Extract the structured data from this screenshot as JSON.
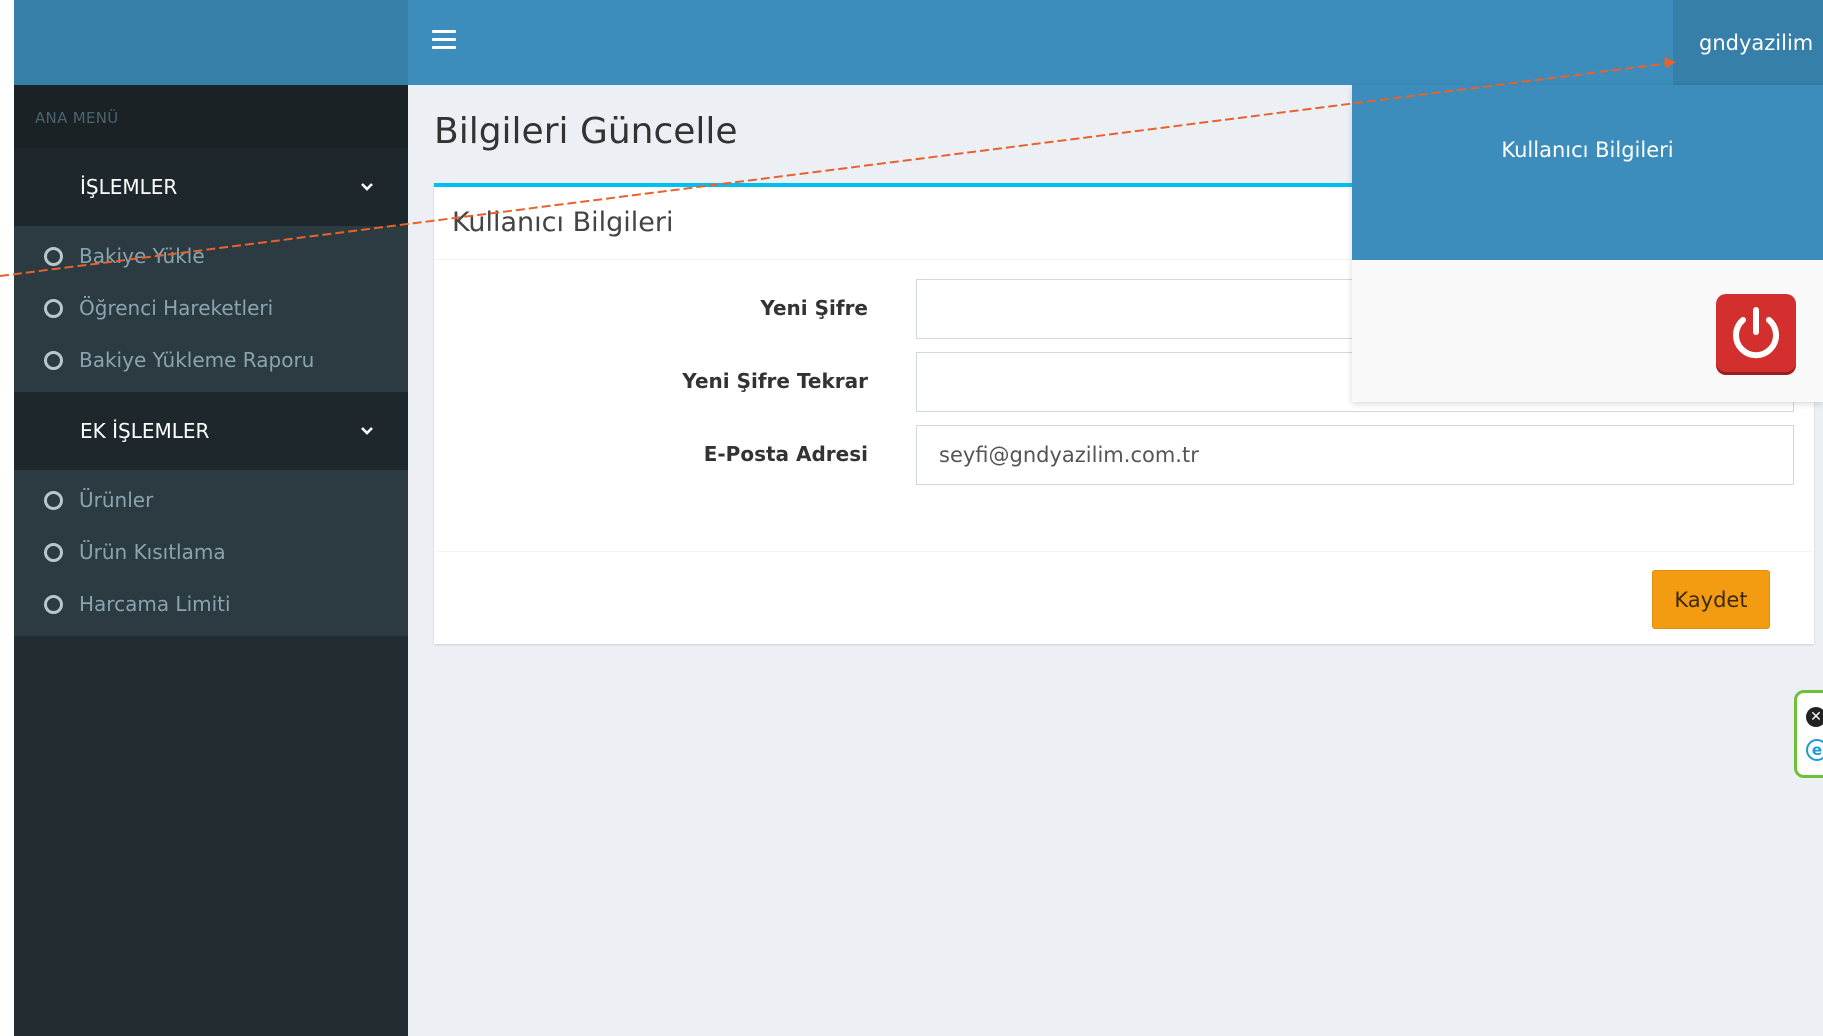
{
  "sidebar": {
    "menu_header": "ANA MENÜ",
    "groups": [
      {
        "label": "İŞLEMLER",
        "items": [
          {
            "label": "Bakiye Yükle"
          },
          {
            "label": "Öğrenci Hareketleri"
          },
          {
            "label": "Bakiye Yükleme Raporu"
          }
        ]
      },
      {
        "label": "EK İŞLEMLER",
        "items": [
          {
            "label": "Ürünler"
          },
          {
            "label": "Ürün Kısıtlama"
          },
          {
            "label": "Harcama Limiti"
          }
        ]
      }
    ]
  },
  "navbar": {
    "menu_icon": "hamburger-icon",
    "username": "gndyazilim"
  },
  "dropdown": {
    "header": "Kullanıcı Bilgileri",
    "logout_icon": "power-icon"
  },
  "content": {
    "page_title": "Bilgileri Güncelle",
    "box_title": "Kullanıcı Bilgileri",
    "fields": [
      {
        "label": "Yeni Şifre",
        "value": ""
      },
      {
        "label": "Yeni Şifre Tekrar",
        "value": ""
      },
      {
        "label": "E-Posta Adresi",
        "value": "seyfi@gndyazilim.com.tr"
      }
    ],
    "save_label": "Kaydet"
  },
  "colors": {
    "navbar": "#3c8dbc",
    "sidebar": "#222d32",
    "accent_border": "#00c0ef",
    "save_button": "#f39c12",
    "annotation_line": "#e8622c"
  }
}
